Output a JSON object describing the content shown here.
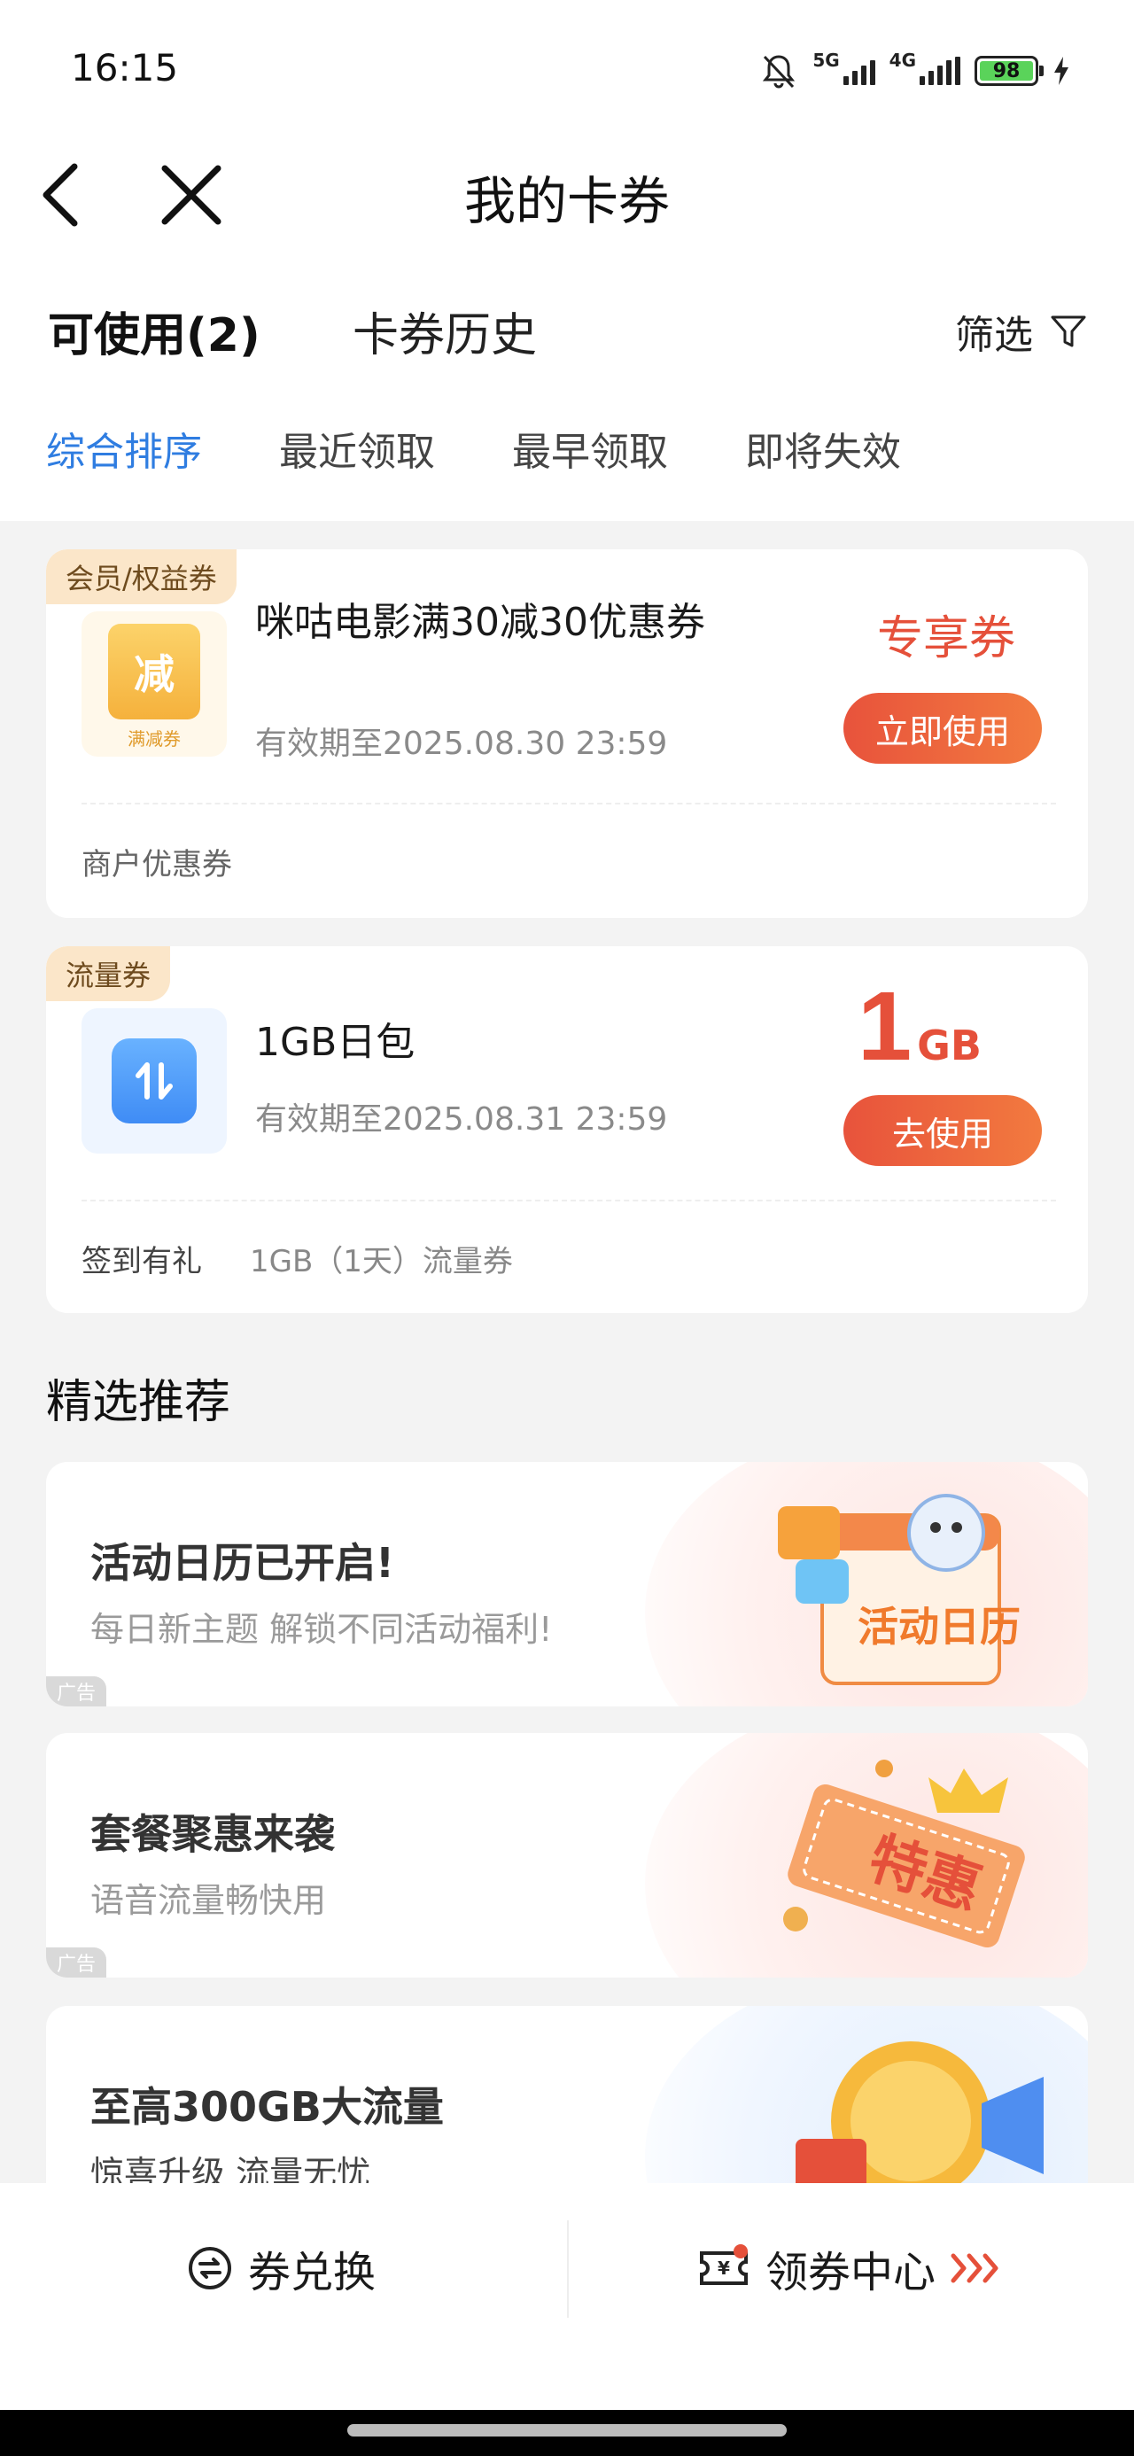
{
  "status": {
    "time": "16:15",
    "net1": "5G",
    "net2": "4G",
    "battery": "98"
  },
  "nav": {
    "title": "我的卡券"
  },
  "tabs": {
    "available": "可使用(2)",
    "history": "卡券历史",
    "filter": "筛选"
  },
  "sort": [
    "综合排序",
    "最近领取",
    "最早领取",
    "即将失效"
  ],
  "coupons": [
    {
      "tag": "会员/权益券",
      "icon_text": "减",
      "icon_caption": "满减券",
      "name": "咪咕电影满30减30优惠券",
      "expiry": "有效期至2025.08.30 23:59",
      "badge": "专享券",
      "button": "立即使用",
      "footer": "商户优惠券"
    },
    {
      "tag": "流量券",
      "name": "1GB日包",
      "expiry": "有效期至2025.08.31 23:59",
      "value": "1",
      "unit": "GB",
      "button": "去使用",
      "footer_left": "签到有礼",
      "footer_right": "1GB（1天）流量券"
    }
  ],
  "recommend": {
    "title": "精选推荐",
    "items": [
      {
        "title": "活动日历已开启!",
        "subtitle": "每日新主题 解锁不同活动福利!",
        "ad": "广告",
        "art_text": "活动日历"
      },
      {
        "title": "套餐聚惠来袭",
        "subtitle": "语音流量畅快用",
        "ad": "广告",
        "art_text": "特惠"
      },
      {
        "title": "至高300GB大流量",
        "subtitle": "惊喜升级 流量无忧"
      }
    ]
  },
  "bottom": {
    "exchange": "券兑换",
    "center": "领券中心"
  },
  "colors": {
    "accent": "#2f7de1",
    "primary_red": "#e5503a",
    "tag_bg": "#fbe6c9"
  }
}
